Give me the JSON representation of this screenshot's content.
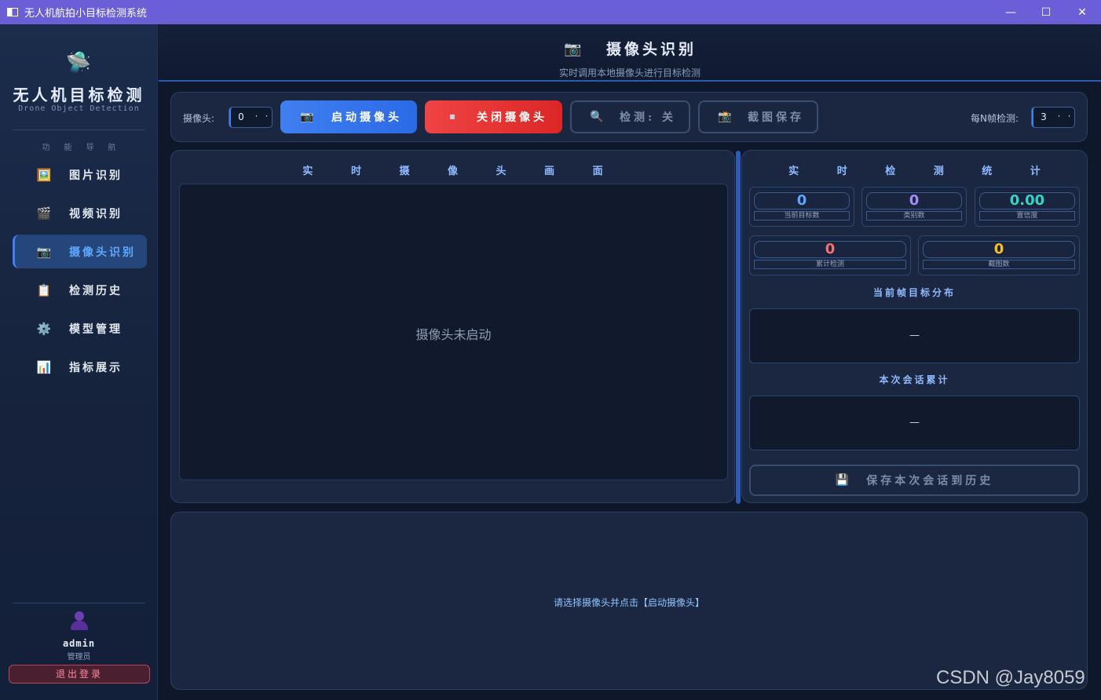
{
  "window": {
    "title": "无人机航拍小目标检测系统",
    "controls": [
      "—",
      "☐",
      "✕"
    ]
  },
  "sidebar": {
    "logo_icon": "🛸",
    "brand": "无人机目标检测",
    "brand_sub": "Drone Object Detection",
    "nav_title": "功能导航",
    "items": [
      {
        "icon": "🖼️",
        "icon_name": "image-icon",
        "label": "图片识别",
        "active": false
      },
      {
        "icon": "🎬",
        "icon_name": "video-icon",
        "label": "视频识别",
        "active": false
      },
      {
        "icon": "📷",
        "icon_name": "camera-icon",
        "label": "摄像头识别",
        "active": true
      },
      {
        "icon": "📋",
        "icon_name": "clipboard-icon",
        "label": "检测历史",
        "active": false
      },
      {
        "icon": "⚙️",
        "icon_name": "gear-icon",
        "label": "模型管理",
        "active": false
      },
      {
        "icon": "📊",
        "icon_name": "chart-icon",
        "label": "指标展示",
        "active": false
      }
    ],
    "user": {
      "name": "admin",
      "role": "管理员"
    },
    "logout_label": "退出登录"
  },
  "header": {
    "icon": "📷",
    "title": "摄像头识别",
    "subtitle": "实时调用本地摄像头进行目标检测"
  },
  "toolbar": {
    "camera_label": "摄像头:",
    "camera_value": "0",
    "start_icon": "📷",
    "start_label": "启动摄像头",
    "stop_icon": "⏹",
    "stop_label": "关闭摄像头",
    "detect_icon": "🔍",
    "detect_label": "检测: 关",
    "snapshot_icon": "📸",
    "snapshot_label": "截图保存",
    "interval_label": "每N帧检测:",
    "interval_value": "3",
    "spin_glyph": "·"
  },
  "video": {
    "title": "实 时 摄 像 头 画 面",
    "placeholder": "摄像头未启动"
  },
  "stats": {
    "title": "实 时 检 测 统 计",
    "current_targets": {
      "value": "0",
      "label": "当前目标数",
      "color": "#60a5fa"
    },
    "classes": {
      "value": "0",
      "label": "类别数",
      "color": "#a78bfa"
    },
    "confidence": {
      "value": "0.00",
      "label": "置信度",
      "color": "#34d3c6"
    },
    "total_detect": {
      "value": "0",
      "label": "累计检测",
      "color": "#f87171"
    },
    "screenshots": {
      "value": "0",
      "label": "截图数",
      "color": "#fbbf24"
    },
    "frame_dist_title": "当前帧目标分布",
    "frame_dist_value": "—",
    "session_title": "本次会话累计",
    "session_value": "—",
    "save_icon": "💾",
    "save_label": "保存本次会话到历史"
  },
  "log": {
    "message": "请选择摄像头并点击【启动摄像头】"
  },
  "watermark": "CSDN @Jay8059"
}
